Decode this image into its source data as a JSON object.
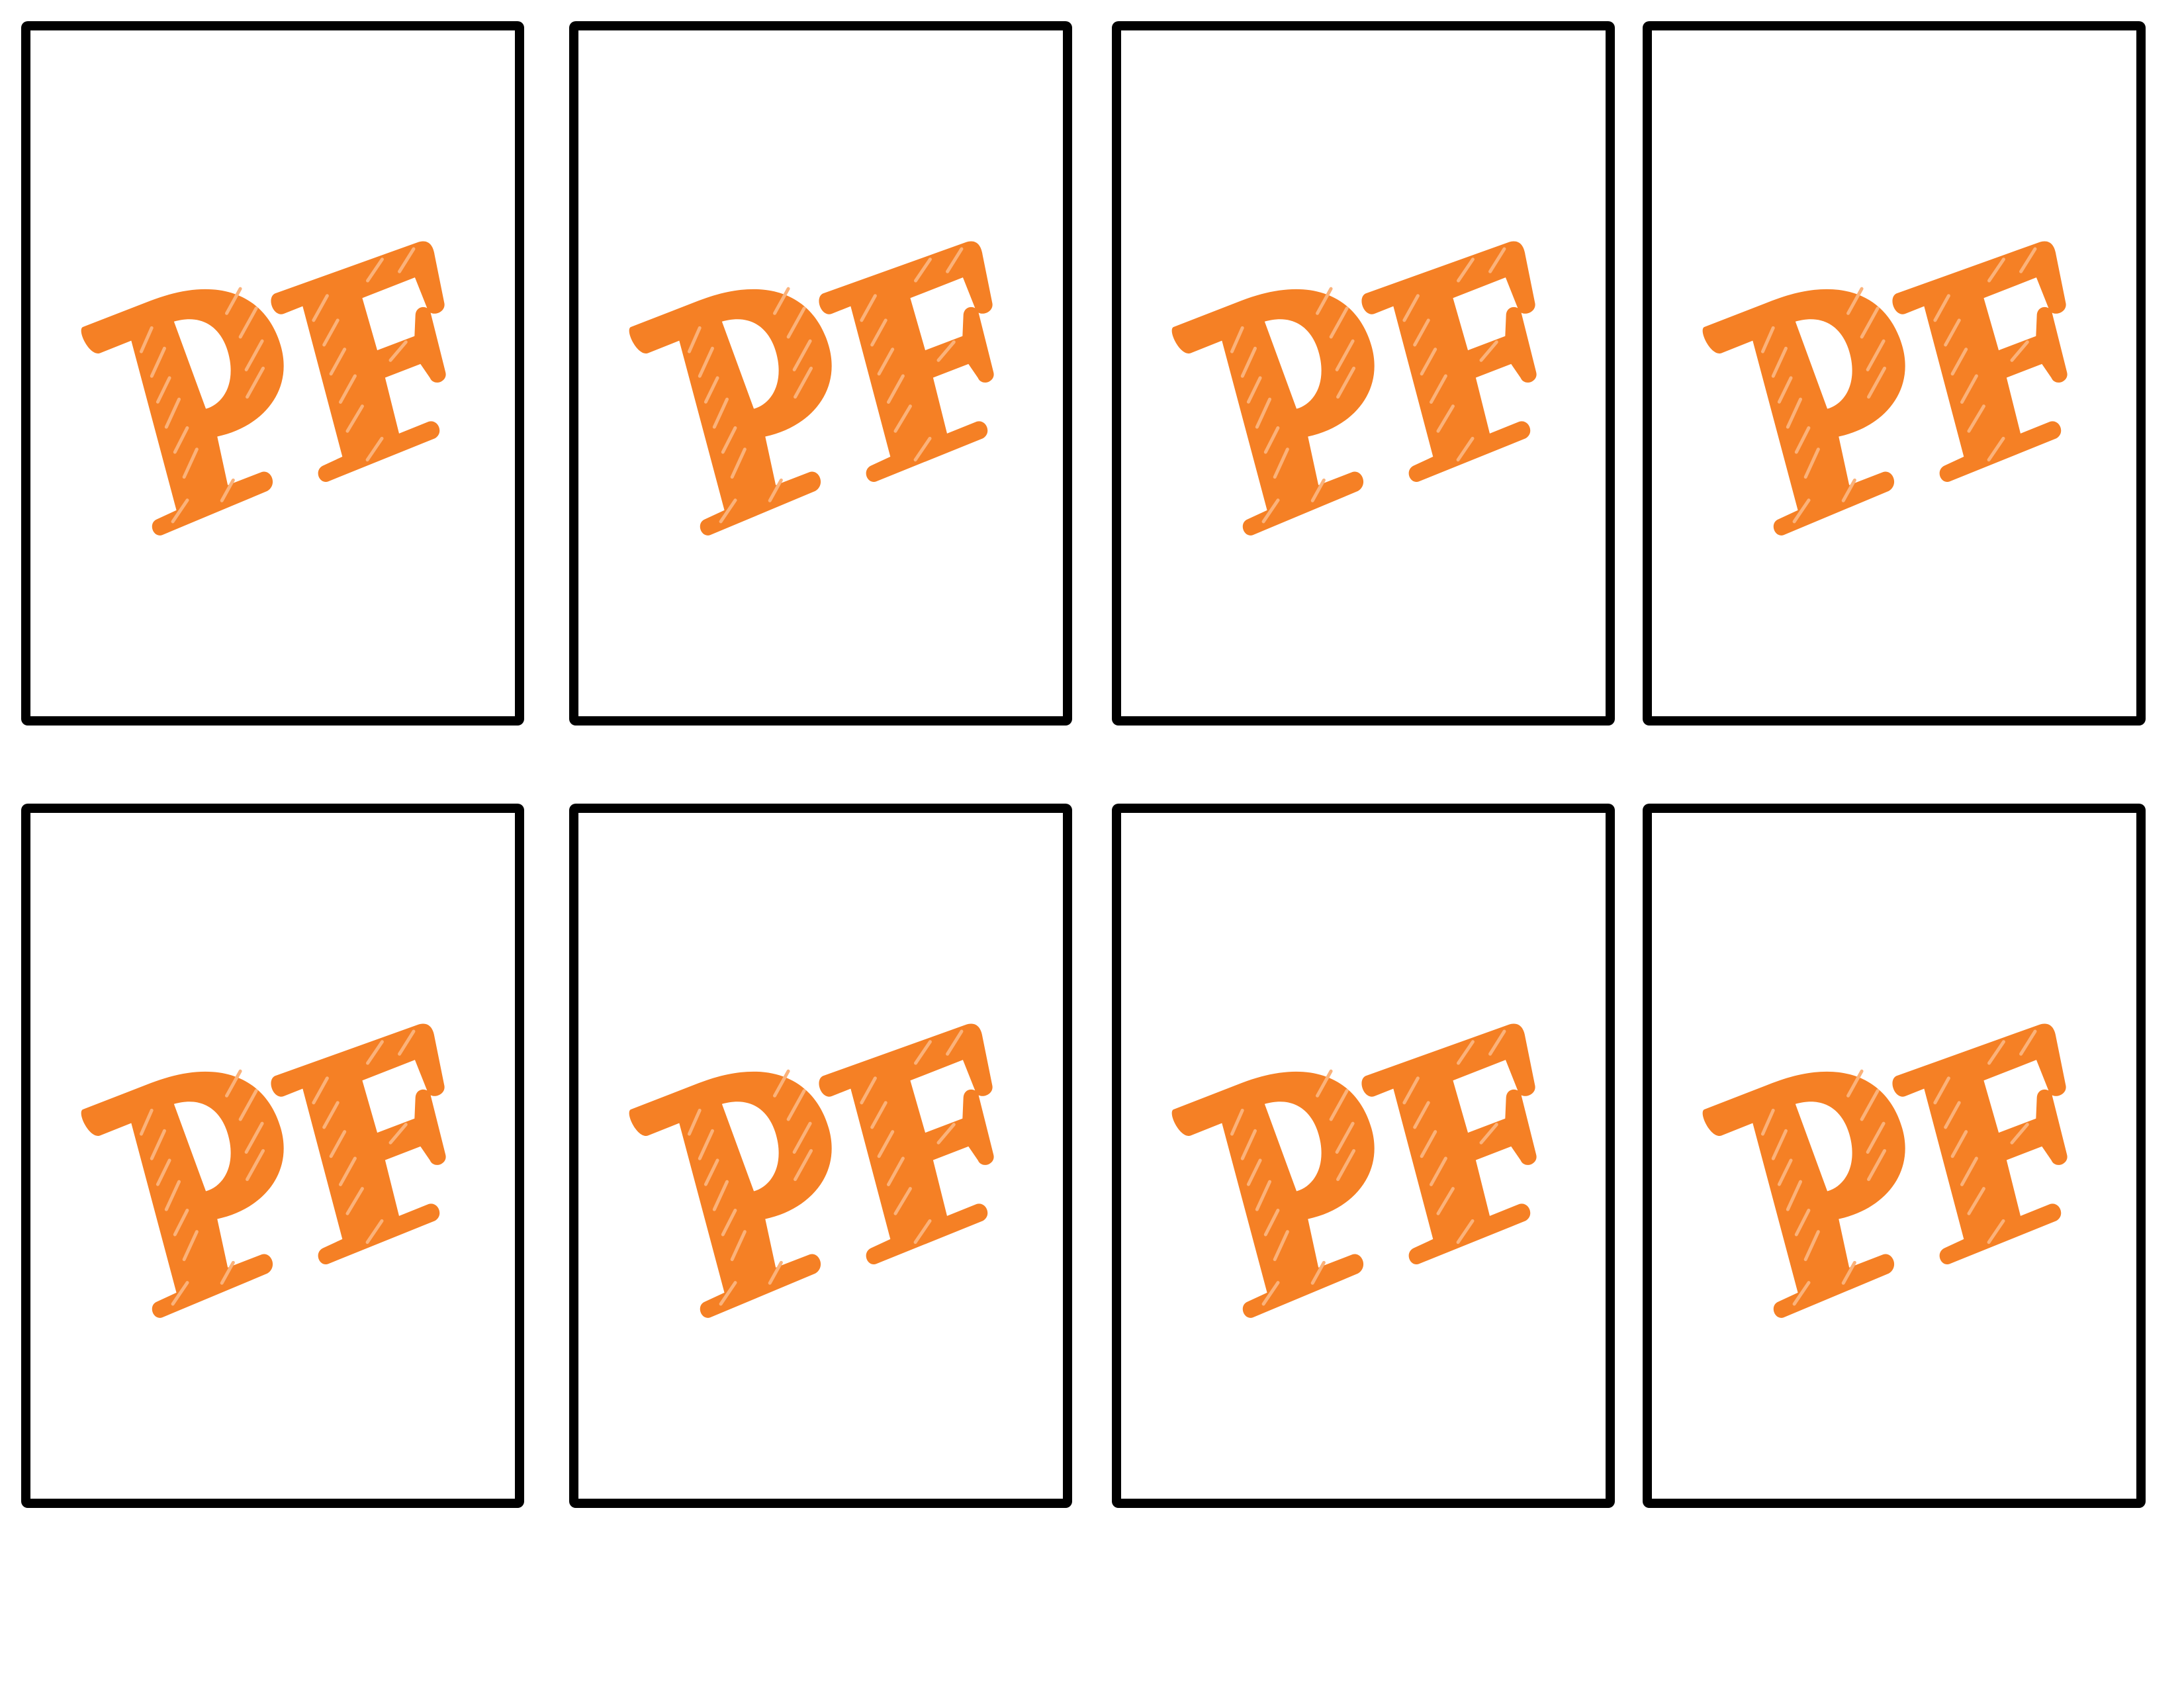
{
  "sheet": {
    "background_color": "#ffffff",
    "card_border_color": "#000000",
    "logo_color": "#f58025",
    "logo_hatch_color": "#fbb27a",
    "cards": [
      {
        "logo_text": "PF"
      },
      {
        "logo_text": "PF"
      },
      {
        "logo_text": "PF"
      },
      {
        "logo_text": "PF"
      },
      {
        "logo_text": "PF"
      },
      {
        "logo_text": "PF"
      },
      {
        "logo_text": "PF"
      },
      {
        "logo_text": "PF"
      }
    ]
  }
}
